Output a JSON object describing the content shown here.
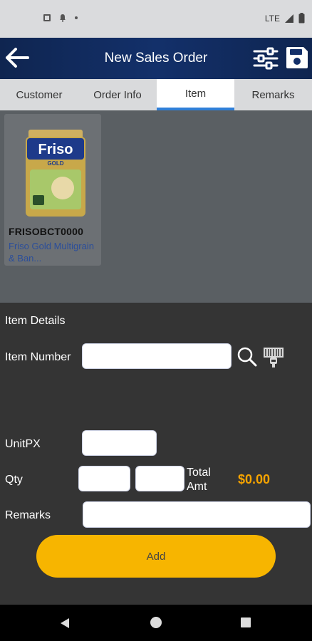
{
  "status_bar": {
    "network": "LTE"
  },
  "app_bar": {
    "title": "New Sales Order"
  },
  "tabs": [
    {
      "label": "Customer"
    },
    {
      "label": "Order Info"
    },
    {
      "label": "Item"
    },
    {
      "label": "Remarks"
    }
  ],
  "items": [
    {
      "code": "FRISOBCT0000",
      "description": "Friso Gold Multigrain & Ban...",
      "package_brand": "Friso",
      "package_subtitle": "GOLD"
    }
  ],
  "item_details": {
    "heading": "Item Details",
    "item_number_label": "Item Number",
    "item_number_value": "",
    "unit_px_label": "UnitPX",
    "unit_px_value": "",
    "qty_label": "Qty",
    "qty_value_1": "",
    "qty_value_2": "",
    "total_amt_label_line1": "Total",
    "total_amt_label_line2": "Amt",
    "total_amt_value": "$0.00",
    "remarks_label": "Remarks",
    "remarks_value": "",
    "add_label": "Add"
  },
  "colors": {
    "app_bar": "#13306a",
    "accent_tab": "#2f7fd8",
    "add_button": "#f7b500",
    "total_value": "#f5a300"
  }
}
